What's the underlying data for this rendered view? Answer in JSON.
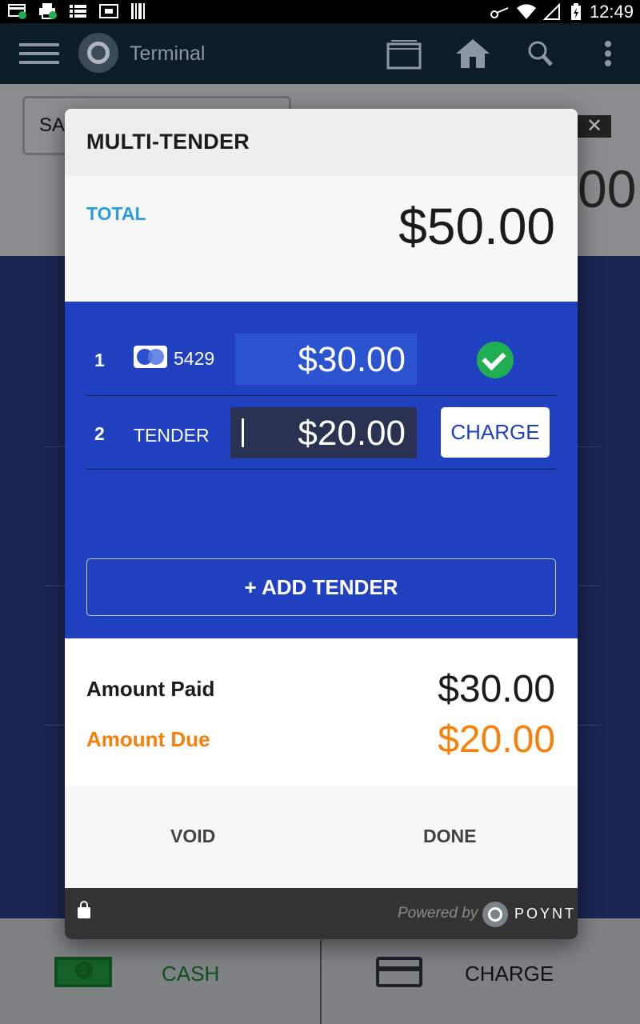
{
  "status_bar": {
    "time": "12:49"
  },
  "app_bar": {
    "title": "Terminal"
  },
  "background": {
    "select_text": "SAL",
    "big_amount_fragment": "00",
    "close_glyph": "✕",
    "cash_label": "CASH",
    "charge_label": "CHARGE"
  },
  "modal": {
    "title": "MULTI-TENDER",
    "total_label": "TOTAL",
    "total_amount": "$50.00",
    "tenders": [
      {
        "index": "1",
        "card_last4": "5429",
        "amount": "$30.00",
        "status": "paid"
      },
      {
        "index": "2",
        "label": "TENDER",
        "amount": "$20.00",
        "action_label": "CHARGE"
      }
    ],
    "add_tender_label": "+ ADD TENDER",
    "amount_paid_label": "Amount Paid",
    "amount_paid": "$30.00",
    "amount_due_label": "Amount Due",
    "amount_due": "$20.00",
    "void_label": "VOID",
    "done_label": "DONE",
    "powered_by": "Powered by",
    "brand": "POYNT"
  },
  "colors": {
    "accent_blue": "#2140bf",
    "total_label": "#2a9de0",
    "due_orange": "#f7800a",
    "success_green": "#1faf52"
  }
}
